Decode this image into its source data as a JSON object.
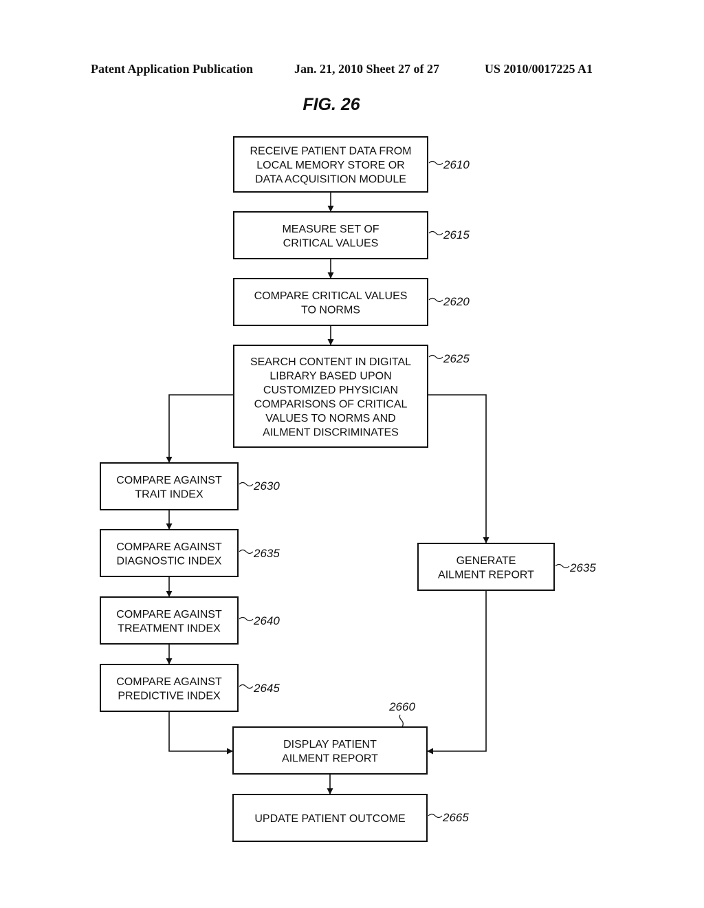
{
  "header": {
    "publication": "Patent Application Publication",
    "date_sheet": "Jan. 21, 2010  Sheet 27 of 27",
    "patent_number": "US 2010/0017225 A1"
  },
  "figure": {
    "title": "FIG. 26"
  },
  "steps": [
    {
      "id": "s2610",
      "ref": "2610",
      "lines": [
        "RECEIVE PATIENT DATA FROM",
        "LOCAL MEMORY STORE OR",
        "DATA ACQUISITION MODULE"
      ]
    },
    {
      "id": "s2615",
      "ref": "2615",
      "lines": [
        "MEASURE SET OF",
        "CRITICAL VALUES"
      ]
    },
    {
      "id": "s2620",
      "ref": "2620",
      "lines": [
        "COMPARE CRITICAL VALUES",
        "TO NORMS"
      ]
    },
    {
      "id": "s2625",
      "ref": "2625",
      "lines": [
        "SEARCH CONTENT IN DIGITAL",
        "LIBRARY BASED UPON",
        "CUSTOMIZED PHYSICIAN",
        "COMPARISONS OF CRITICAL",
        "VALUES TO NORMS AND",
        "AILMENT DISCRIMINATES"
      ]
    },
    {
      "id": "s2630",
      "ref": "2630",
      "lines": [
        "COMPARE AGAINST",
        "TRAIT INDEX"
      ]
    },
    {
      "id": "s2635a",
      "ref": "2635",
      "lines": [
        "COMPARE AGAINST",
        "DIAGNOSTIC INDEX"
      ]
    },
    {
      "id": "s2640",
      "ref": "2640",
      "lines": [
        "COMPARE AGAINST",
        "TREATMENT INDEX"
      ]
    },
    {
      "id": "s2645",
      "ref": "2645",
      "lines": [
        "COMPARE AGAINST",
        "PREDICTIVE INDEX"
      ]
    },
    {
      "id": "s2635b",
      "ref": "2635",
      "lines": [
        "GENERATE",
        "AILMENT REPORT"
      ]
    },
    {
      "id": "s2660",
      "ref": "2660",
      "lines": [
        "DISPLAY PATIENT",
        "AILMENT REPORT"
      ]
    },
    {
      "id": "s2665",
      "ref": "2665",
      "lines": [
        "UPDATE PATIENT OUTCOME"
      ]
    }
  ],
  "connections": [
    {
      "from": "s2610",
      "to": "s2615"
    },
    {
      "from": "s2615",
      "to": "s2620"
    },
    {
      "from": "s2620",
      "to": "s2625"
    },
    {
      "from": "s2625",
      "to": "s2630"
    },
    {
      "from": "s2625",
      "to": "s2635b"
    },
    {
      "from": "s2630",
      "to": "s2635a"
    },
    {
      "from": "s2635a",
      "to": "s2640"
    },
    {
      "from": "s2640",
      "to": "s2645"
    },
    {
      "from": "s2645",
      "to": "s2660"
    },
    {
      "from": "s2635b",
      "to": "s2660"
    },
    {
      "from": "s2660",
      "to": "s2665"
    }
  ]
}
